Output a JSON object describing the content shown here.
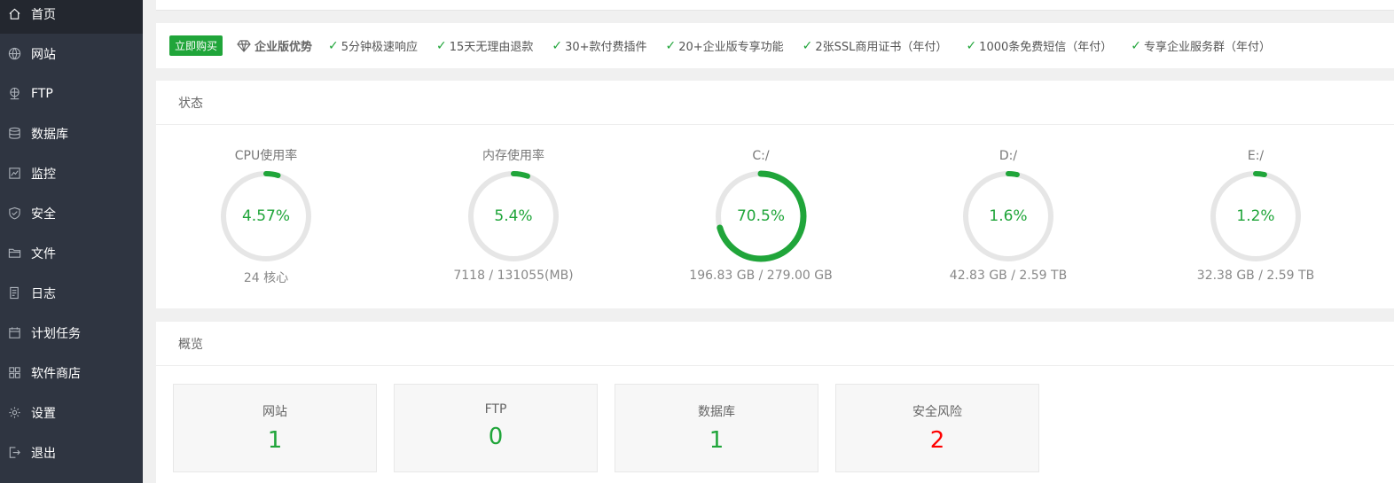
{
  "sidebar": {
    "items": [
      {
        "label": "首页",
        "icon": "home-icon"
      },
      {
        "label": "网站",
        "icon": "globe-icon"
      },
      {
        "label": "FTP",
        "icon": "ftp-icon"
      },
      {
        "label": "数据库",
        "icon": "database-icon"
      },
      {
        "label": "监控",
        "icon": "monitor-icon"
      },
      {
        "label": "安全",
        "icon": "shield-icon"
      },
      {
        "label": "文件",
        "icon": "folder-icon"
      },
      {
        "label": "日志",
        "icon": "log-icon"
      },
      {
        "label": "计划任务",
        "icon": "calendar-icon"
      },
      {
        "label": "软件商店",
        "icon": "grid-icon"
      },
      {
        "label": "设置",
        "icon": "gear-icon"
      },
      {
        "label": "退出",
        "icon": "logout-icon"
      }
    ]
  },
  "promo": {
    "buy_label": "立即购买",
    "enterprise_label": "企业版优势",
    "features": [
      "5分钟极速响应",
      "15天无理由退款",
      "30+款付费插件",
      "20+企业版专享功能",
      "2张SSL商用证书（年付）",
      "1000条免费短信（年付）",
      "专享企业服务群（年付）"
    ]
  },
  "status": {
    "title": "状态",
    "gauges": [
      {
        "title": "CPU使用率",
        "value": "4.57%",
        "percent": 4.57,
        "sub": "24 核心"
      },
      {
        "title": "内存使用率",
        "value": "5.4%",
        "percent": 5.4,
        "sub": "7118 / 131055(MB)"
      },
      {
        "title": "C:/",
        "value": "70.5%",
        "percent": 70.5,
        "sub": "196.83 GB / 279.00 GB"
      },
      {
        "title": "D:/",
        "value": "1.6%",
        "percent": 1.6,
        "sub": "42.83 GB / 2.59 TB"
      },
      {
        "title": "E:/",
        "value": "1.2%",
        "percent": 1.2,
        "sub": "32.38 GB / 2.59 TB"
      }
    ]
  },
  "overview": {
    "title": "概览",
    "cards": [
      {
        "label": "网站",
        "value": "1"
      },
      {
        "label": "FTP",
        "value": "0"
      },
      {
        "label": "数据库",
        "value": "1"
      },
      {
        "label": "安全风险",
        "value": "2"
      }
    ]
  },
  "colors": {
    "accent": "#20a53a",
    "danger": "#ff0000",
    "sidebar_bg": "#2f3541",
    "ring_track": "#e6e6e6"
  }
}
